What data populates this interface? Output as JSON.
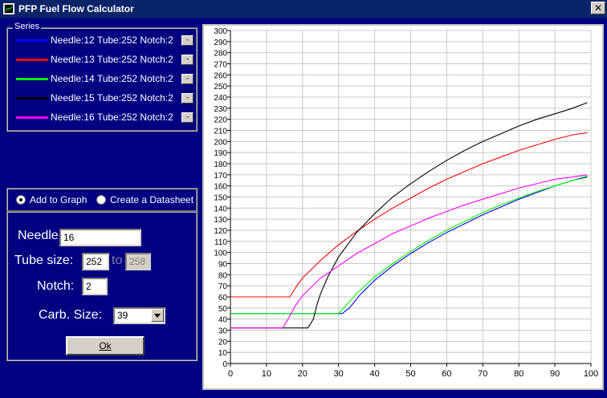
{
  "window": {
    "title": "PFP Fuel Flow Calculator",
    "close_glyph": "✕"
  },
  "series_panel": {
    "caption": "Series",
    "remove_glyph": "-",
    "items": [
      {
        "label": "Needle:12  Tube:252  Notch:2",
        "color": "#0000ff"
      },
      {
        "label": "Needle:13  Tube:252  Notch:2",
        "color": "#ff0000"
      },
      {
        "label": "Needle:14  Tube:252  Notch:2",
        "color": "#00ff00"
      },
      {
        "label": "Needle:15  Tube:252  Notch:2",
        "color": "#000000"
      },
      {
        "label": "Needle:16  Tube:252  Notch:2",
        "color": "#ff00ff"
      }
    ]
  },
  "mode": {
    "add_to_graph": "Add to Graph",
    "create_datasheet": "Create a Datasheet",
    "selected": "add_to_graph"
  },
  "inputs": {
    "needle_label": "Needle K:",
    "needle_value": "16",
    "tube_label": "Tube size:",
    "tube_value": "252",
    "to_label": "to",
    "tube_to_value": "258",
    "notch_label": "Notch:",
    "notch_value": "2",
    "carb_label": "Carb. Size:",
    "carb_value": "39",
    "ok_label": "Ok"
  },
  "chart_data": {
    "type": "line",
    "xlim": [
      0,
      100
    ],
    "ylim": [
      0,
      300
    ],
    "xticks": [
      0,
      10,
      20,
      30,
      40,
      50,
      60,
      70,
      80,
      90,
      100
    ],
    "yticks": [
      0,
      10,
      20,
      30,
      40,
      50,
      60,
      70,
      80,
      90,
      100,
      110,
      120,
      130,
      140,
      150,
      160,
      170,
      180,
      190,
      200,
      210,
      220,
      230,
      240,
      250,
      260,
      270,
      280,
      290,
      300
    ],
    "grid": true,
    "series": [
      {
        "color": "#0000ff",
        "points": [
          [
            0,
            45
          ],
          [
            31,
            45
          ],
          [
            33,
            50
          ],
          [
            36,
            62
          ],
          [
            40,
            75
          ],
          [
            45,
            88
          ],
          [
            50,
            99
          ],
          [
            55,
            109
          ],
          [
            60,
            118
          ],
          [
            65,
            126
          ],
          [
            70,
            134
          ],
          [
            75,
            141
          ],
          [
            80,
            148
          ],
          [
            85,
            154
          ],
          [
            90,
            160
          ],
          [
            95,
            165
          ],
          [
            99,
            168
          ]
        ]
      },
      {
        "color": "#ff0000",
        "points": [
          [
            0,
            60
          ],
          [
            16.5,
            60
          ],
          [
            18,
            68
          ],
          [
            20,
            77
          ],
          [
            25,
            93
          ],
          [
            30,
            107
          ],
          [
            35,
            119
          ],
          [
            40,
            130
          ],
          [
            45,
            140
          ],
          [
            50,
            149
          ],
          [
            55,
            158
          ],
          [
            60,
            166
          ],
          [
            65,
            173
          ],
          [
            70,
            180
          ],
          [
            75,
            186
          ],
          [
            80,
            192
          ],
          [
            85,
            197
          ],
          [
            90,
            202
          ],
          [
            95,
            206
          ],
          [
            99,
            208
          ]
        ]
      },
      {
        "color": "#00ff00",
        "points": [
          [
            0,
            45
          ],
          [
            30,
            45
          ],
          [
            32,
            52
          ],
          [
            35,
            63
          ],
          [
            40,
            78
          ],
          [
            45,
            90
          ],
          [
            50,
            101
          ],
          [
            55,
            111
          ],
          [
            60,
            120
          ],
          [
            65,
            128
          ],
          [
            70,
            136
          ],
          [
            75,
            143
          ],
          [
            80,
            149
          ],
          [
            85,
            155
          ],
          [
            90,
            160
          ],
          [
            95,
            165
          ],
          [
            99,
            169
          ]
        ]
      },
      {
        "color": "#000000",
        "points": [
          [
            0,
            32
          ],
          [
            21.5,
            32
          ],
          [
            23,
            40
          ],
          [
            24,
            53
          ],
          [
            25,
            63
          ],
          [
            27,
            78
          ],
          [
            30,
            96
          ],
          [
            35,
            118
          ],
          [
            40,
            135
          ],
          [
            45,
            150
          ],
          [
            50,
            162
          ],
          [
            55,
            173
          ],
          [
            60,
            183
          ],
          [
            65,
            192
          ],
          [
            70,
            200
          ],
          [
            75,
            207
          ],
          [
            80,
            214
          ],
          [
            85,
            220
          ],
          [
            90,
            225
          ],
          [
            95,
            230
          ],
          [
            99,
            235
          ]
        ]
      },
      {
        "color": "#ff00ff",
        "points": [
          [
            0,
            32
          ],
          [
            14.5,
            32
          ],
          [
            16,
            40
          ],
          [
            18,
            52
          ],
          [
            20,
            61
          ],
          [
            25,
            77
          ],
          [
            30,
            88
          ],
          [
            35,
            99
          ],
          [
            40,
            108
          ],
          [
            45,
            117
          ],
          [
            50,
            124
          ],
          [
            55,
            131
          ],
          [
            60,
            137
          ],
          [
            65,
            143
          ],
          [
            70,
            148
          ],
          [
            75,
            153
          ],
          [
            80,
            158
          ],
          [
            85,
            162
          ],
          [
            90,
            166
          ],
          [
            95,
            168
          ],
          [
            99,
            170
          ]
        ]
      }
    ]
  }
}
